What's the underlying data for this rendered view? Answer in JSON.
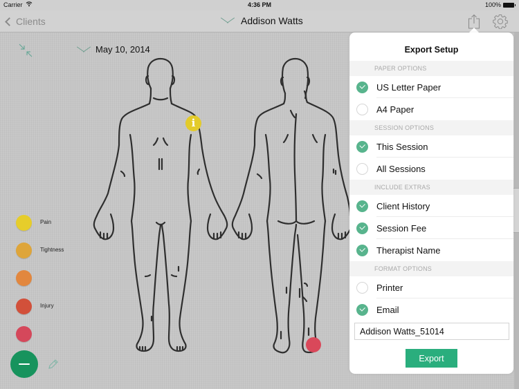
{
  "status_bar": {
    "carrier": "Carrier",
    "time": "4:36 PM",
    "battery": "100%"
  },
  "nav": {
    "back_label": "Clients",
    "client_name": "Addison Watts",
    "icons": [
      "share-icon",
      "gear-icon"
    ]
  },
  "session": {
    "date": "May 10, 2014"
  },
  "legend": [
    {
      "label": "Pain",
      "color": "#e6cd2b"
    },
    {
      "label": "Tightness",
      "color": "#dea53a"
    },
    {
      "label": "",
      "color": "#e2873e"
    },
    {
      "label": "Injury",
      "color": "#d2503a"
    },
    {
      "label": "",
      "color": "#d5485b"
    }
  ],
  "markers": [
    {
      "type": "info",
      "glyph": "i",
      "color": "#e3cb2a",
      "view": "front",
      "location": "left shoulder"
    },
    {
      "type": "point",
      "color": "#d9485a",
      "view": "back",
      "location": "right heel"
    }
  ],
  "export_popover": {
    "title": "Export Setup",
    "sections": [
      {
        "header": "PAPER OPTIONS",
        "options": [
          {
            "label": "US Letter Paper",
            "checked": true
          },
          {
            "label": "A4 Paper",
            "checked": false
          }
        ]
      },
      {
        "header": "SESSION OPTIONS",
        "options": [
          {
            "label": "This Session",
            "checked": true
          },
          {
            "label": "All Sessions",
            "checked": false
          }
        ]
      },
      {
        "header": "INCLUDE EXTRAS",
        "options": [
          {
            "label": "Client History",
            "checked": true
          },
          {
            "label": "Session Fee",
            "checked": true
          },
          {
            "label": "Therapist Name",
            "checked": true
          }
        ]
      },
      {
        "header": "FORMAT OPTIONS",
        "options": [
          {
            "label": "Printer",
            "checked": false
          },
          {
            "label": "Email",
            "checked": true
          }
        ]
      }
    ],
    "filename_value": "Addison Watts_51014",
    "export_label": "Export",
    "accent_color": "#2aae7d"
  }
}
